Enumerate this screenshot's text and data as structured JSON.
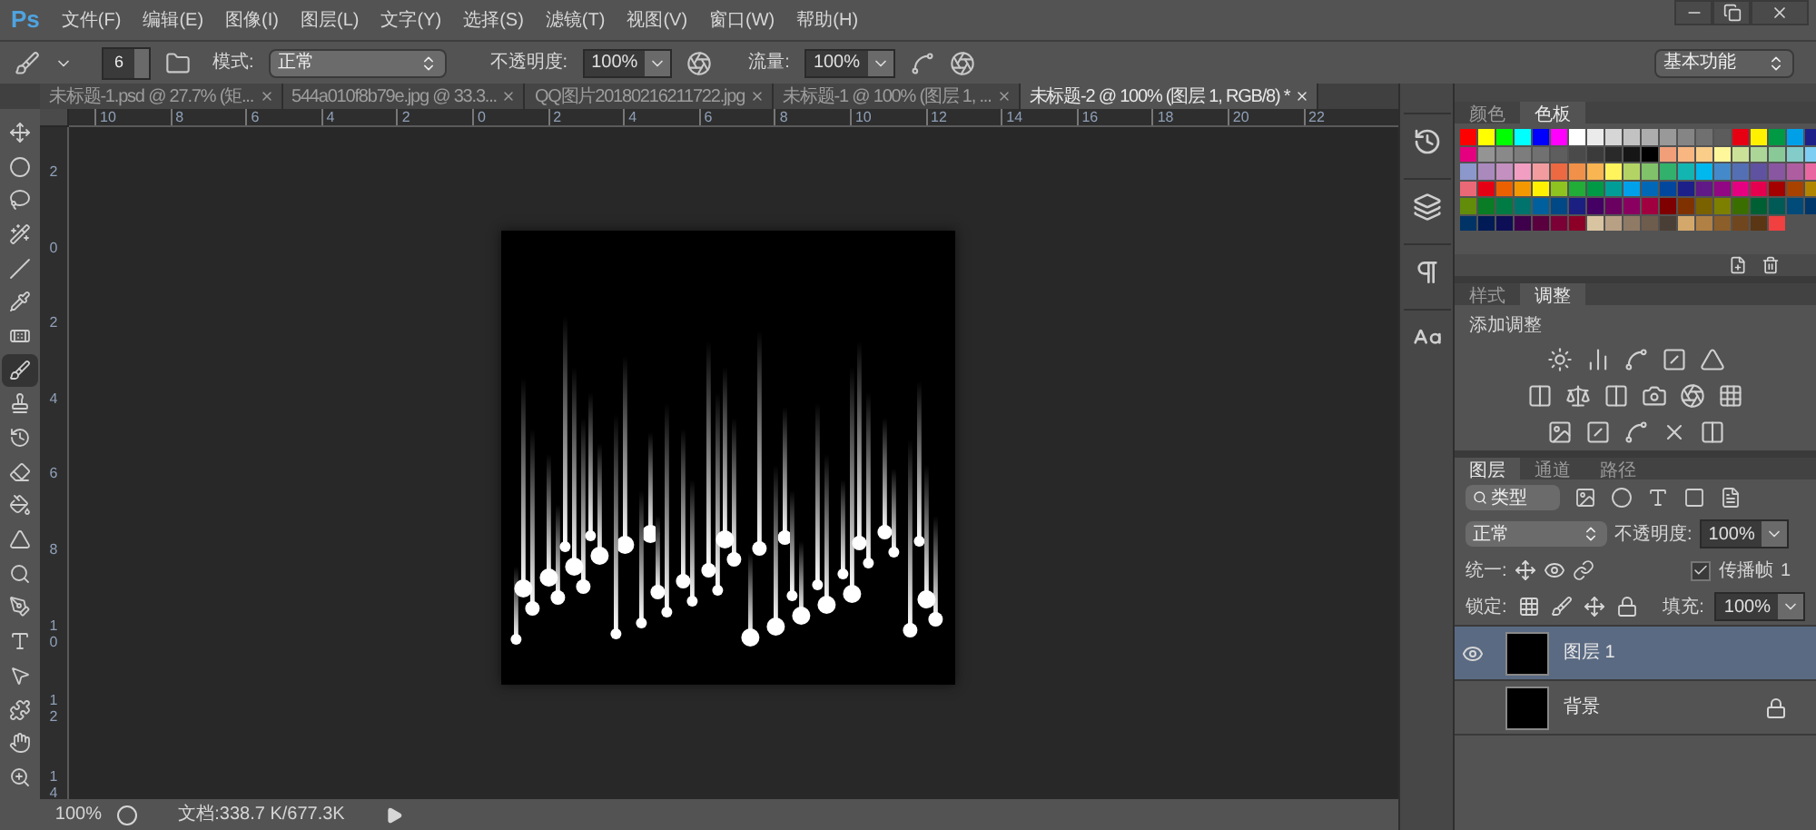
{
  "menu_bar": {
    "logo": "Ps",
    "items": [
      "文件(F)",
      "编辑(E)",
      "图像(I)",
      "图层(L)",
      "文字(Y)",
      "选择(S)",
      "滤镜(T)",
      "视图(V)",
      "窗口(W)",
      "帮助(H)"
    ]
  },
  "options_bar": {
    "brush_size": "6",
    "mode_label": "模式:",
    "mode": "正常",
    "opacity_label": "不透明度:",
    "opacity": "100%",
    "flow_label": "流量:",
    "flow": "100%",
    "workspace": "基本功能"
  },
  "document_tabs": [
    {
      "title": "未标题-1.psd @ 27.7% (矩...",
      "selected": false
    },
    {
      "title": "544a010f8b79e.jpg @ 33.3...",
      "selected": false
    },
    {
      "title": "QQ图片20180216211722.jpg",
      "selected": false
    },
    {
      "title": "未标题-1 @ 100% (图层 1, ...",
      "selected": false
    },
    {
      "title": "未标题-2 @ 100% (图层 1, RGB/8) *",
      "selected": true
    }
  ],
  "tools": [
    {
      "kind": "move",
      "selected": false
    },
    {
      "kind": "marquee",
      "selected": false
    },
    {
      "kind": "lasso",
      "selected": false
    },
    {
      "kind": "wand",
      "selected": false
    },
    {
      "kind": "pen",
      "selected": false
    },
    {
      "kind": "eyedropper",
      "selected": false
    },
    {
      "kind": "bandage",
      "selected": false
    },
    {
      "kind": "brush",
      "selected": true
    },
    {
      "kind": "stamp",
      "selected": false
    },
    {
      "kind": "history",
      "selected": false
    },
    {
      "kind": "eraser",
      "selected": false
    },
    {
      "kind": "bucket",
      "selected": false
    },
    {
      "kind": "blur",
      "selected": false
    },
    {
      "kind": "dodge",
      "selected": false
    },
    {
      "kind": "pentool",
      "selected": false
    },
    {
      "kind": "type",
      "selected": false
    },
    {
      "kind": "select",
      "selected": false
    },
    {
      "kind": "shape",
      "selected": false
    },
    {
      "kind": "hand",
      "selected": false
    },
    {
      "kind": "zoom",
      "selected": false
    }
  ],
  "rulers": {
    "horizontal": [
      "10",
      "8",
      "6",
      "4",
      "2",
      "0",
      "2",
      "4",
      "6",
      "8",
      "10",
      "12",
      "14",
      "16",
      "18",
      "20",
      "22"
    ],
    "vertical": [
      "2",
      "0",
      "2",
      "4",
      "6",
      "8",
      "10",
      "12",
      "14"
    ]
  },
  "status_bar": {
    "zoom": "100%",
    "document_info": "文档:338.7 K/677.3K"
  },
  "swatches_panel": {
    "tabs": [
      {
        "label": "颜色",
        "selected": false
      },
      {
        "label": "色板",
        "selected": true
      }
    ],
    "swatches": [
      {
        "color": "#ff0000"
      },
      {
        "color": "#ffff00"
      },
      {
        "color": "#00ff00"
      },
      {
        "color": "#00ffff"
      },
      {
        "color": "#0000ff"
      },
      {
        "color": "#ff00ff"
      },
      {
        "color": "#ffffff"
      },
      {
        "color": "#ebebeb"
      },
      {
        "color": "#d6d6d6"
      },
      {
        "color": "#c2c2c2"
      },
      {
        "color": "#adadad"
      },
      {
        "color": "#999999"
      },
      {
        "color": "#858585"
      },
      {
        "color": "#707070"
      },
      {
        "color": "#5c5c5c"
      },
      {
        "color": "#e60012"
      },
      {
        "color": "#fff100"
      },
      {
        "color": "#009944"
      },
      {
        "color": "#00a0e9"
      },
      {
        "color": "#1d2088"
      },
      {
        "color": "#e4007f"
      },
      {
        "color": "#949494"
      },
      {
        "color": "#898989"
      },
      {
        "color": "#7d7d7d"
      },
      {
        "color": "#717171"
      },
      {
        "color": "#5e5e5e"
      },
      {
        "color": "#4a4a4a"
      },
      {
        "color": "#3b3b3b"
      },
      {
        "color": "#2a2a2a"
      },
      {
        "color": "#161616"
      },
      {
        "color": "#000000"
      },
      {
        "color": "#f19f79"
      },
      {
        "color": "#f8b681"
      },
      {
        "color": "#facd89"
      },
      {
        "color": "#fff799"
      },
      {
        "color": "#cce198"
      },
      {
        "color": "#acd598"
      },
      {
        "color": "#89c997"
      },
      {
        "color": "#84ccc9"
      },
      {
        "color": "#7ecef4"
      },
      {
        "color": "#8c97cb"
      },
      {
        "color": "#aa89bd"
      },
      {
        "color": "#c490bf"
      },
      {
        "color": "#f19ec2"
      },
      {
        "color": "#f29c9f"
      },
      {
        "color": "#ec6941"
      },
      {
        "color": "#f19149"
      },
      {
        "color": "#f8b551"
      },
      {
        "color": "#fff45c"
      },
      {
        "color": "#b3d465"
      },
      {
        "color": "#80c269"
      },
      {
        "color": "#32b16c"
      },
      {
        "color": "#13b5b1"
      },
      {
        "color": "#00b7ee"
      },
      {
        "color": "#448aca"
      },
      {
        "color": "#556fb5"
      },
      {
        "color": "#5f52a0"
      },
      {
        "color": "#8957a1"
      },
      {
        "color": "#ae5da1"
      },
      {
        "color": "#ea68a2"
      },
      {
        "color": "#eb6877"
      },
      {
        "color": "#e60013"
      },
      {
        "color": "#eb6100"
      },
      {
        "color": "#f39800"
      },
      {
        "color": "#fff101"
      },
      {
        "color": "#8fc31f"
      },
      {
        "color": "#22ac38"
      },
      {
        "color": "#009945"
      },
      {
        "color": "#009e96"
      },
      {
        "color": "#00a0ea"
      },
      {
        "color": "#0068b7"
      },
      {
        "color": "#00479d"
      },
      {
        "color": "#1d2089"
      },
      {
        "color": "#601986"
      },
      {
        "color": "#920783"
      },
      {
        "color": "#e40080"
      },
      {
        "color": "#e5004f"
      },
      {
        "color": "#a40000"
      },
      {
        "color": "#a84200"
      },
      {
        "color": "#b28500"
      },
      {
        "color": "#638c0b"
      },
      {
        "color": "#097c25"
      },
      {
        "color": "#007b43"
      },
      {
        "color": "#00736d"
      },
      {
        "color": "#00609d"
      },
      {
        "color": "#004986"
      },
      {
        "color": "#1c1f82"
      },
      {
        "color": "#440062"
      },
      {
        "color": "#6a005f"
      },
      {
        "color": "#8a0060"
      },
      {
        "color": "#a10040"
      },
      {
        "color": "#7e0000"
      },
      {
        "color": "#7f3200"
      },
      {
        "color": "#7a6200"
      },
      {
        "color": "#7c7f00"
      },
      {
        "color": "#3b6e00"
      },
      {
        "color": "#006034"
      },
      {
        "color": "#005a56"
      },
      {
        "color": "#004b7a"
      },
      {
        "color": "#00376a"
      },
      {
        "color": "#003366"
      },
      {
        "color": "#001b56"
      },
      {
        "color": "#0e0e56"
      },
      {
        "color": "#3e004a"
      },
      {
        "color": "#5a003e"
      },
      {
        "color": "#7a0036"
      },
      {
        "color": "#8c0028"
      },
      {
        "color": "#d9c4a1"
      },
      {
        "color": "#b8a084"
      },
      {
        "color": "#8f7a66"
      },
      {
        "color": "#6e5c4d"
      },
      {
        "color": "#4a3f36"
      },
      {
        "color": "#d4a86a"
      },
      {
        "color": "#b08045"
      },
      {
        "color": "#8c5e2a"
      },
      {
        "color": "#70461e"
      },
      {
        "color": "#5a3614"
      },
      {
        "color": "#f04040"
      }
    ]
  },
  "adjustments_panel": {
    "tabs": [
      {
        "label": "样式",
        "selected": false
      },
      {
        "label": "调整",
        "selected": true
      }
    ],
    "heading": "添加调整"
  },
  "layers_panel": {
    "tabs": [
      {
        "label": "图层",
        "selected": true
      },
      {
        "label": "通道",
        "selected": false
      },
      {
        "label": "路径",
        "selected": false
      }
    ],
    "filter": "类型",
    "blend_mode": "正常",
    "opacity_label": "不透明度:",
    "opacity": "100%",
    "unify_label": "统一:",
    "propagate": {
      "label": "传播帧",
      "checked": true
    },
    "frame": "1",
    "lock_label": "锁定:",
    "fill_label": "填充:",
    "fill": "100%",
    "layers": [
      {
        "name": "图层 1",
        "selected": true,
        "visible": true,
        "locked": false
      },
      {
        "name": "背景",
        "selected": false,
        "visible": false,
        "locked": true
      }
    ]
  }
}
